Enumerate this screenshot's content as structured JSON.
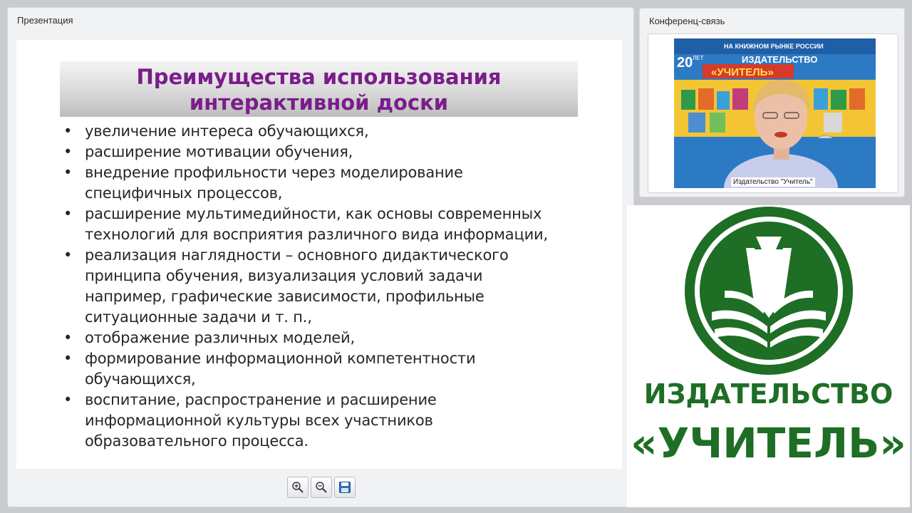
{
  "presentation": {
    "title": "Презентация",
    "slide": {
      "heading_lines": [
        "Преимущества использования",
        "интерактивной доски"
      ],
      "bullet_symbol": "•",
      "bullets": [
        [
          "увеличение интереса обучающихся,"
        ],
        [
          "расширение мотивации обучения,"
        ],
        [
          "внедрение профильности через моделирование",
          "специфичных процессов,"
        ],
        [
          "расширение мультимедийности, как основы современных",
          "технологий для восприятия различного вида информации,"
        ],
        [
          "реализация наглядности – основного дидактического",
          "принципа обучения, визуализация условий задачи",
          "например, графические зависимости, профильные",
          "ситуационные задачи и т. п.,"
        ],
        [
          "отображение различных моделей,"
        ],
        [
          "формирование информационной компетентности",
          "обучающихся,"
        ],
        [
          "воспитание, распространение и расширение",
          "информационной культуры всех участников",
          "образовательного процесса."
        ]
      ]
    },
    "toolbar": [
      "zoom-in-icon",
      "zoom-out-icon",
      "save-icon"
    ]
  },
  "conference": {
    "title": "Конференц-связь",
    "video_caption": "Издательство \"Учитель\"",
    "banner": {
      "top_text": "НА КНИЖНОМ РЫНКЕ РОССИИ",
      "years": "20",
      "years_word": "ЛЕТ",
      "publisher": "ИЗДАТЕЛЬСТВО",
      "name": "«УЧИТЕЛЬ»"
    }
  },
  "logo": {
    "line1": "ИЗДАТЕЛЬСТВО",
    "line2": "«УЧИТЕЛЬ»",
    "color": "#1e6e25"
  }
}
